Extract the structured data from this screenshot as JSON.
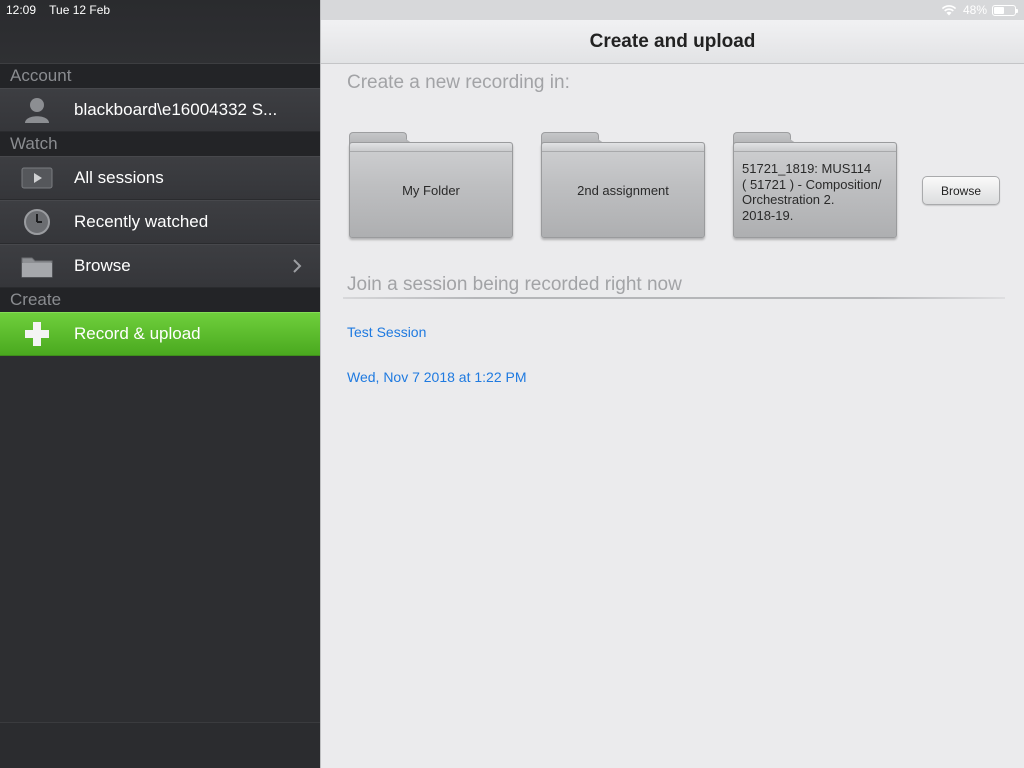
{
  "status": {
    "time": "12:09",
    "date": "Tue 12 Feb",
    "battery": "48%",
    "battery_level": 0.48
  },
  "sidebar": {
    "sections": {
      "account": "Account",
      "watch": "Watch",
      "create": "Create"
    },
    "account_name": "blackboard\\e16004332 S...",
    "items": [
      {
        "label": "All sessions",
        "icon": "play-icon"
      },
      {
        "label": "Recently watched",
        "icon": "clock-icon"
      },
      {
        "label": "Browse",
        "icon": "folder-icon"
      },
      {
        "label": "Record & upload",
        "icon": "plus-icon"
      }
    ]
  },
  "main": {
    "title": "Create and upload",
    "prompt": "Create a new recording in:",
    "folders": [
      {
        "label": "My Folder"
      },
      {
        "label": "2nd assignment"
      },
      {
        "label_lines": [
          "51721_1819: MUS114",
          "( 51721 ) - Composition/",
          "Orchestration 2.",
          "2018-19."
        ]
      }
    ],
    "browse_button": "Browse",
    "join_heading": "Join a session being recorded right now",
    "sessions": [
      {
        "name": "Test Session"
      },
      {
        "name": "Wed, Nov 7 2018 at 1:22 PM"
      }
    ]
  },
  "colors": {
    "accent_green": "#5bbd2b",
    "link_blue": "#1f7ae0",
    "sidebar_bg": "#2d2e31"
  }
}
